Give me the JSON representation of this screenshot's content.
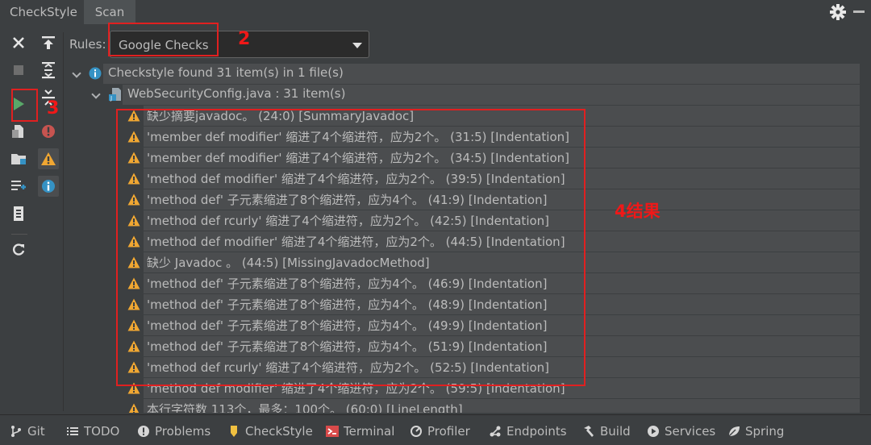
{
  "window": {
    "tabs": [
      {
        "label": "CheckStyle"
      },
      {
        "label": "Scan"
      }
    ]
  },
  "rules": {
    "label": "Rules:",
    "selected": "Google Checks"
  },
  "tree": {
    "summary": "Checkstyle found 31 item(s) in 1 file(s)",
    "file": "WebSecurityConfig.java : 31 item(s)",
    "items": [
      "缺少摘要javadoc。 (24:0) [SummaryJavadoc]",
      "'member def modifier' 缩进了4个缩进符，应为2个。 (31:5) [Indentation]",
      "'member def modifier' 缩进了4个缩进符，应为2个。 (34:5) [Indentation]",
      "'method def modifier' 缩进了4个缩进符，应为2个。 (39:5) [Indentation]",
      "'method def' 子元素缩进了8个缩进符，应为4个。 (41:9) [Indentation]",
      "'method def rcurly' 缩进了4个缩进符，应为2个。 (42:5) [Indentation]",
      "'method def modifier' 缩进了4个缩进符，应为2个。 (44:5) [Indentation]",
      "缺少 Javadoc 。 (44:5) [MissingJavadocMethod]",
      "'method def' 子元素缩进了8个缩进符，应为4个。 (46:9) [Indentation]",
      "'method def' 子元素缩进了8个缩进符，应为4个。 (48:9) [Indentation]",
      "'method def' 子元素缩进了8个缩进符，应为4个。 (49:9) [Indentation]",
      "'method def' 子元素缩进了8个缩进符，应为4个。 (51:9) [Indentation]",
      "'method def rcurly' 缩进了4个缩进符，应为2个。 (52:5) [Indentation]",
      "'method def modifier' 缩进了4个缩进符，应为2个。 (59:5) [Indentation]",
      "本行字符数 113个，最多：100个。 (60:0) [LineLength]"
    ]
  },
  "annotations": {
    "rules_marker": "2",
    "run_marker": "3",
    "results_marker": "4结果"
  },
  "bottom_bar": {
    "items": [
      {
        "label": "Git",
        "icon": "git-branch-icon"
      },
      {
        "label": "TODO",
        "icon": "todo-list-icon"
      },
      {
        "label": "Problems",
        "icon": "problems-info-icon"
      },
      {
        "label": "CheckStyle",
        "icon": "checkstyle-icon"
      },
      {
        "label": "Terminal",
        "icon": "terminal-icon"
      },
      {
        "label": "Profiler",
        "icon": "profiler-icon"
      },
      {
        "label": "Endpoints",
        "icon": "endpoints-icon"
      },
      {
        "label": "Build",
        "icon": "build-hammer-icon"
      },
      {
        "label": "Services",
        "icon": "services-icon"
      },
      {
        "label": "Spring",
        "icon": "spring-leaf-icon"
      }
    ]
  },
  "colors": {
    "background": "#3c3f41",
    "row_highlight": "#4b4d4f",
    "warning": "#f0a732",
    "run_green": "#59a869",
    "error_red": "#c75450",
    "info_blue": "#3592c4",
    "annotation_red": "#e02020"
  }
}
